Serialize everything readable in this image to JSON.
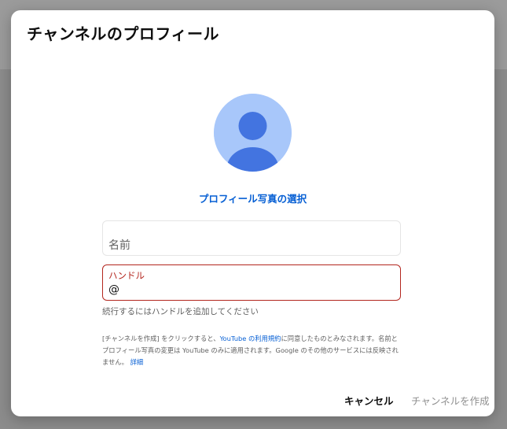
{
  "dialog": {
    "title": "チャンネルのプロフィール",
    "choose_photo_label": "プロフィール写真の選択",
    "name_field": {
      "placeholder": "名前",
      "value": ""
    },
    "handle_field": {
      "label": "ハンドル",
      "prefix": "@",
      "value": ""
    },
    "helper_text": "続行するにはハンドルを追加してください",
    "disclaimer": {
      "part1": "[チャンネルを作成] をクリックすると、",
      "terms_link": "YouTube の利用規約",
      "part2": "に同意したものとみなされます。名前とプロフィール写真の変更は YouTube のみに適用されます。Google のその他のサービスには反映されません。",
      "details_link": "詳細"
    },
    "buttons": {
      "cancel": "キャンセル",
      "create": "チャンネルを作成"
    }
  },
  "colors": {
    "accent": "#065fd4",
    "error": "#b3261e",
    "avatar_bg": "#a8c7fa",
    "avatar_figure": "#4374e0",
    "disabled_text": "#909090"
  },
  "icons": {
    "avatar": "default-person-avatar-icon"
  }
}
